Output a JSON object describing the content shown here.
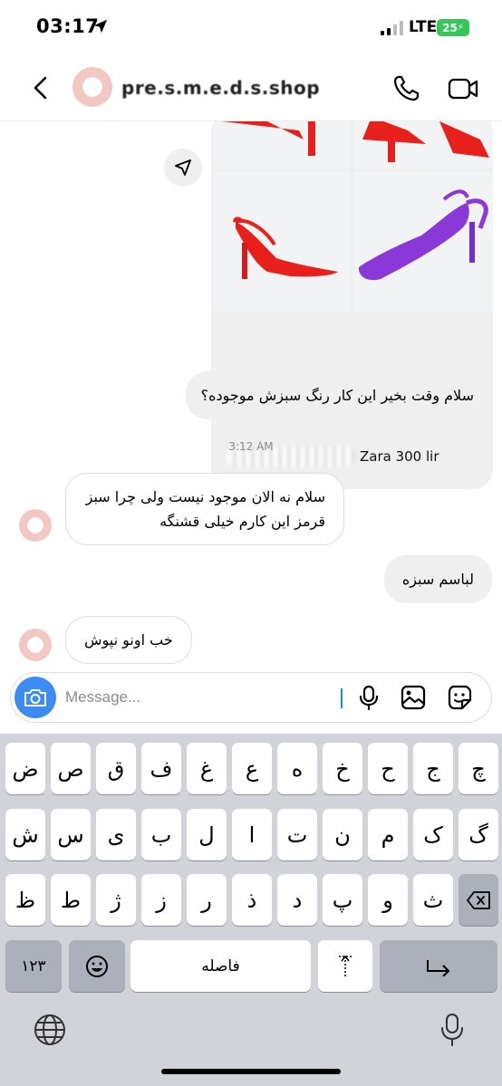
{
  "status_bar": {
    "time": "03:17",
    "network": "LTE",
    "battery": "25"
  },
  "header": {
    "name": "pre.s.m.e.d.s.shop"
  },
  "product_card": {
    "caption": "Zara 300 lir"
  },
  "messages": [
    {
      "side": "out",
      "text": "سلام وقت بخیر این کار رنگ سبزش موجوده؟"
    },
    {
      "side": "in",
      "text": "سلام نه الان موجود نیست ولی چرا سبز قرمز این کارم خیلی قشنگه"
    },
    {
      "side": "out",
      "text": "لباسم سبزه"
    },
    {
      "side": "in",
      "text": "خب اونو نپوش"
    }
  ],
  "timestamp": "3:12 AM",
  "composer": {
    "placeholder": "Message..."
  },
  "keyboard": {
    "row1": [
      "ض",
      "ص",
      "ق",
      "ف",
      "غ",
      "ع",
      "ه",
      "خ",
      "ح",
      "ج",
      "چ"
    ],
    "row2": [
      "ش",
      "س",
      "ی",
      "ب",
      "ل",
      "ا",
      "ت",
      "ن",
      "م",
      "ک",
      "گ"
    ],
    "row3": [
      "ظ",
      "ط",
      "ژ",
      "ز",
      "ر",
      "ذ",
      "د",
      "پ",
      "و",
      "ث"
    ],
    "numbers_key": "۱۲۳",
    "space_label": "فاصله"
  },
  "colors": {
    "accent": "#3d8cf3",
    "battery": "#35c759",
    "shoe_red": "#e8201c",
    "shoe_purple": "#8a38d8"
  }
}
